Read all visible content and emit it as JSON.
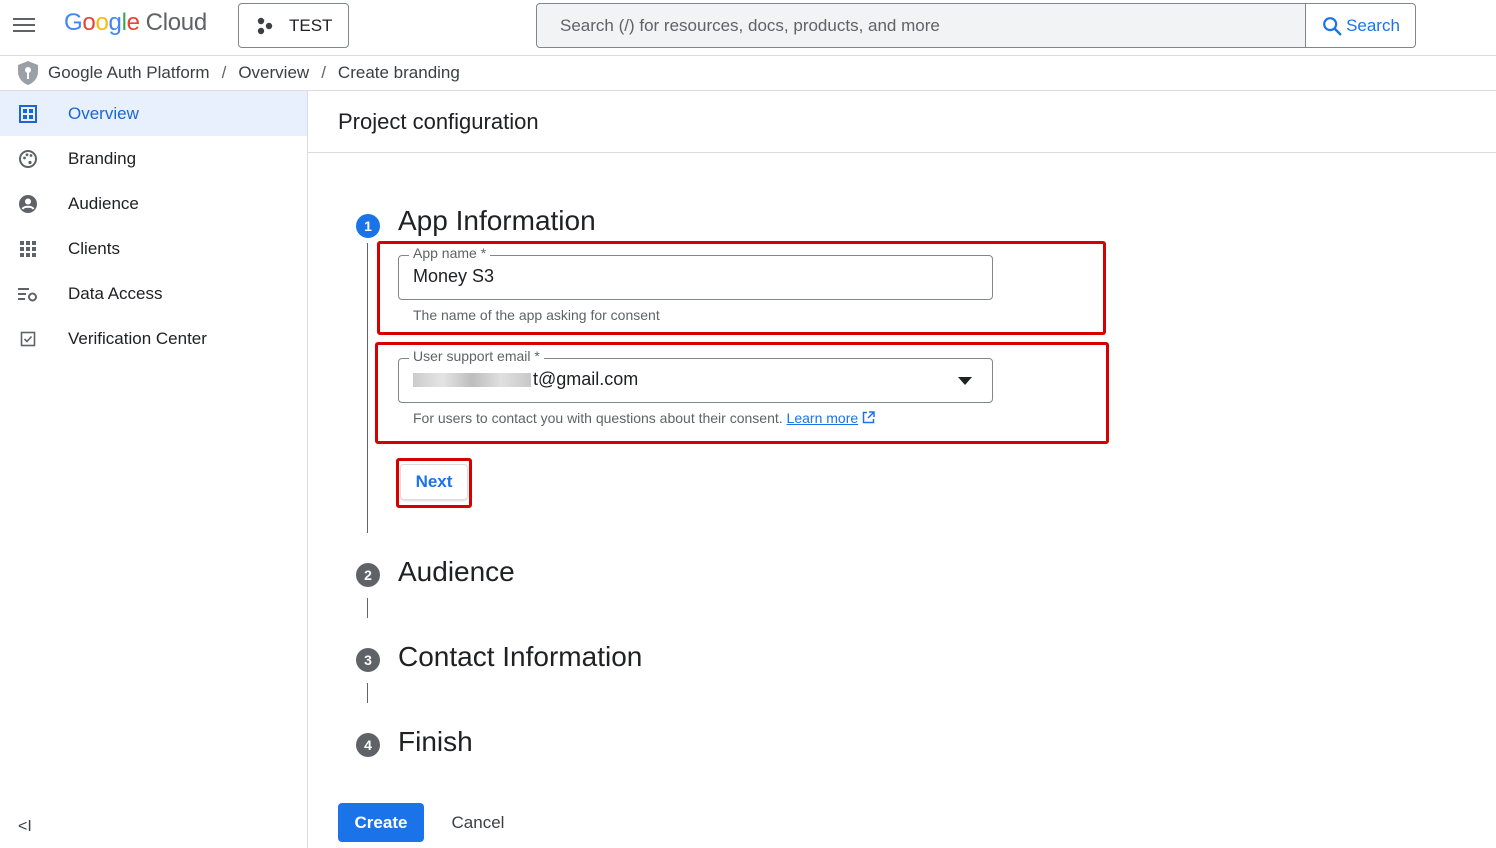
{
  "header": {
    "logo_google": "Google",
    "logo_cloud": "Cloud",
    "project_name": "TEST",
    "search_placeholder": "Search (/) for resources, docs, products, and more",
    "search_button": "Search"
  },
  "breadcrumb": [
    "Google Auth Platform",
    "Overview",
    "Create branding"
  ],
  "sidebar": {
    "items": [
      {
        "label": "Overview",
        "icon": "dashboard-icon",
        "active": true
      },
      {
        "label": "Branding",
        "icon": "palette-icon"
      },
      {
        "label": "Audience",
        "icon": "account-circle-icon"
      },
      {
        "label": "Clients",
        "icon": "apps-grid-icon"
      },
      {
        "label": "Data Access",
        "icon": "data-settings-icon"
      },
      {
        "label": "Verification Center",
        "icon": "checkbox-icon"
      }
    ],
    "collapse_glyph": "<I"
  },
  "main": {
    "title": "Project configuration",
    "steps": [
      {
        "num": "1",
        "title": "App Information"
      },
      {
        "num": "2",
        "title": "Audience"
      },
      {
        "num": "3",
        "title": "Contact Information"
      },
      {
        "num": "4",
        "title": "Finish"
      }
    ],
    "app_name": {
      "label": "App name *",
      "value": "Money S3",
      "helper": "The name of the app asking for consent"
    },
    "support_email": {
      "label": "User support email *",
      "value_visible": "t@gmail.com",
      "helper": "For users to contact you with questions about their consent.",
      "learn_more": "Learn more"
    },
    "next_button": "Next",
    "create_button": "Create",
    "cancel_button": "Cancel"
  },
  "colors": {
    "accent": "#1a73e8",
    "highlight_box": "#d50000",
    "active_nav_bg": "#e8f0fe"
  }
}
